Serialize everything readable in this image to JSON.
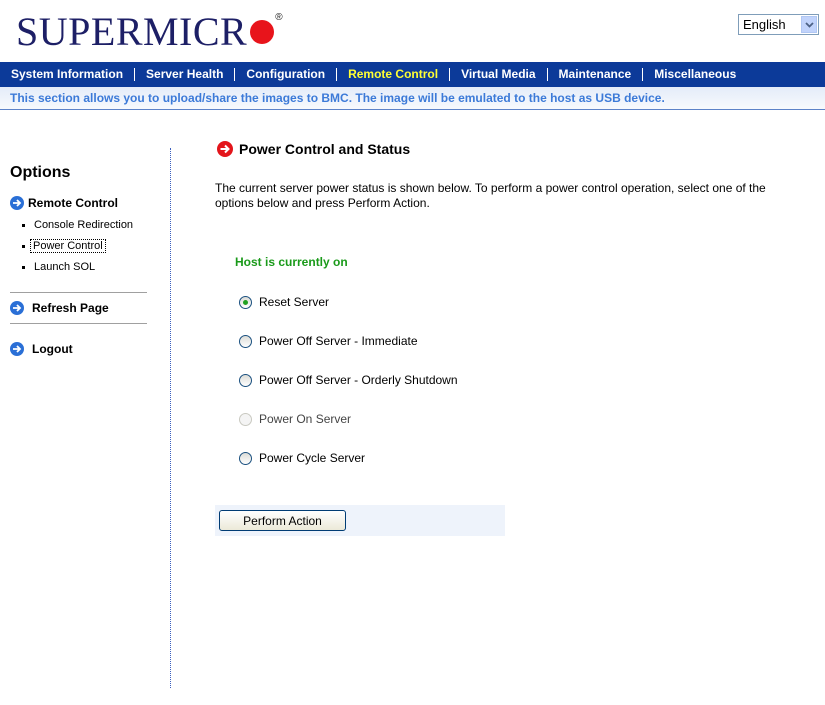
{
  "brand": {
    "logo_text": "SUPERMICR",
    "registered_mark": "®",
    "accent_color": "#e8141b",
    "text_color": "#1d1f66"
  },
  "language": {
    "selected": "English"
  },
  "nav": {
    "items": [
      {
        "label": "System Information"
      },
      {
        "label": "Server Health"
      },
      {
        "label": "Configuration"
      },
      {
        "label": "Remote Control",
        "active": true
      },
      {
        "label": "Virtual Media"
      },
      {
        "label": "Maintenance"
      },
      {
        "label": "Miscellaneous"
      }
    ],
    "bar_color": "#0c3a99",
    "active_color": "#ffff33"
  },
  "infobar": {
    "text": "This section allows you to upload/share the images to BMC. The image will be emulated to the host as USB device."
  },
  "sidebar": {
    "title": "Options",
    "section": "Remote Control",
    "items": [
      {
        "label": "Console Redirection"
      },
      {
        "label": "Power Control",
        "selected": true
      },
      {
        "label": "Launch SOL"
      }
    ],
    "refresh": "Refresh Page",
    "logout": "Logout",
    "icon": "arrow-circle-icon"
  },
  "main": {
    "title": "Power Control and Status",
    "description": "The current server power status is shown below. To perform a power control operation, select one of the options below and press Perform Action.",
    "status": "Host is currently on",
    "status_color": "#1a9a1a",
    "options": [
      {
        "label": "Reset Server",
        "checked": true,
        "disabled": false
      },
      {
        "label": "Power Off Server - Immediate",
        "checked": false,
        "disabled": false
      },
      {
        "label": "Power Off Server - Orderly Shutdown",
        "checked": false,
        "disabled": false
      },
      {
        "label": "Power On Server",
        "checked": false,
        "disabled": true
      },
      {
        "label": "Power Cycle Server",
        "checked": false,
        "disabled": false
      }
    ],
    "action_label": "Perform Action"
  }
}
